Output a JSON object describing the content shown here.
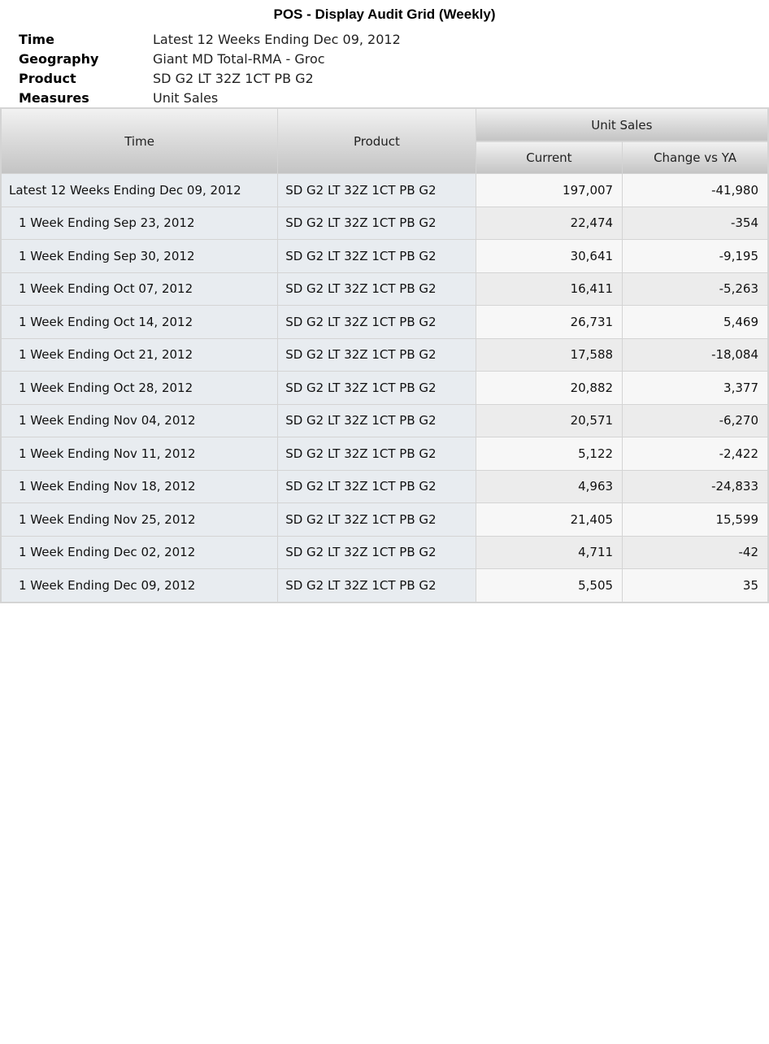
{
  "report": {
    "title": "POS - Display Audit Grid (Weekly)"
  },
  "meta": [
    {
      "label": "Time",
      "value": "Latest 12 Weeks Ending Dec 09, 2012"
    },
    {
      "label": "Geography",
      "value": "Giant MD Total-RMA - Groc"
    },
    {
      "label": "Product",
      "value": "SD G2 LT 32Z 1CT PB G2"
    },
    {
      "label": "Measures",
      "value": "Unit Sales"
    }
  ],
  "grid": {
    "headers": {
      "time": "Time",
      "product": "Product",
      "measure": "Unit Sales",
      "current": "Current",
      "change": "Change vs YA"
    },
    "rows": [
      {
        "time": "Latest 12 Weeks Ending Dec 09, 2012",
        "product": "SD G2 LT 32Z 1CT PB G2",
        "current": "197,007",
        "change": "-41,980",
        "level": 0
      },
      {
        "time": "1 Week Ending Sep 23, 2012",
        "product": "SD G2 LT 32Z 1CT PB G2",
        "current": "22,474",
        "change": "-354",
        "level": 1
      },
      {
        "time": "1 Week Ending Sep 30, 2012",
        "product": "SD G2 LT 32Z 1CT PB G2",
        "current": "30,641",
        "change": "-9,195",
        "level": 1
      },
      {
        "time": "1 Week Ending Oct 07, 2012",
        "product": "SD G2 LT 32Z 1CT PB G2",
        "current": "16,411",
        "change": "-5,263",
        "level": 1
      },
      {
        "time": "1 Week Ending Oct 14, 2012",
        "product": "SD G2 LT 32Z 1CT PB G2",
        "current": "26,731",
        "change": "5,469",
        "level": 1
      },
      {
        "time": "1 Week Ending Oct 21, 2012",
        "product": "SD G2 LT 32Z 1CT PB G2",
        "current": "17,588",
        "change": "-18,084",
        "level": 1
      },
      {
        "time": "1 Week Ending Oct 28, 2012",
        "product": "SD G2 LT 32Z 1CT PB G2",
        "current": "20,882",
        "change": "3,377",
        "level": 1
      },
      {
        "time": "1 Week Ending Nov 04, 2012",
        "product": "SD G2 LT 32Z 1CT PB G2",
        "current": "20,571",
        "change": "-6,270",
        "level": 1
      },
      {
        "time": "1 Week Ending Nov 11, 2012",
        "product": "SD G2 LT 32Z 1CT PB G2",
        "current": "5,122",
        "change": "-2,422",
        "level": 1
      },
      {
        "time": "1 Week Ending Nov 18, 2012",
        "product": "SD G2 LT 32Z 1CT PB G2",
        "current": "4,963",
        "change": "-24,833",
        "level": 1
      },
      {
        "time": "1 Week Ending Nov 25, 2012",
        "product": "SD G2 LT 32Z 1CT PB G2",
        "current": "21,405",
        "change": "15,599",
        "level": 1
      },
      {
        "time": "1 Week Ending Dec 02, 2012",
        "product": "SD G2 LT 32Z 1CT PB G2",
        "current": "4,711",
        "change": "-42",
        "level": 1
      },
      {
        "time": "1 Week Ending Dec 09, 2012",
        "product": "SD G2 LT 32Z 1CT PB G2",
        "current": "5,505",
        "change": "35",
        "level": 1
      }
    ]
  }
}
